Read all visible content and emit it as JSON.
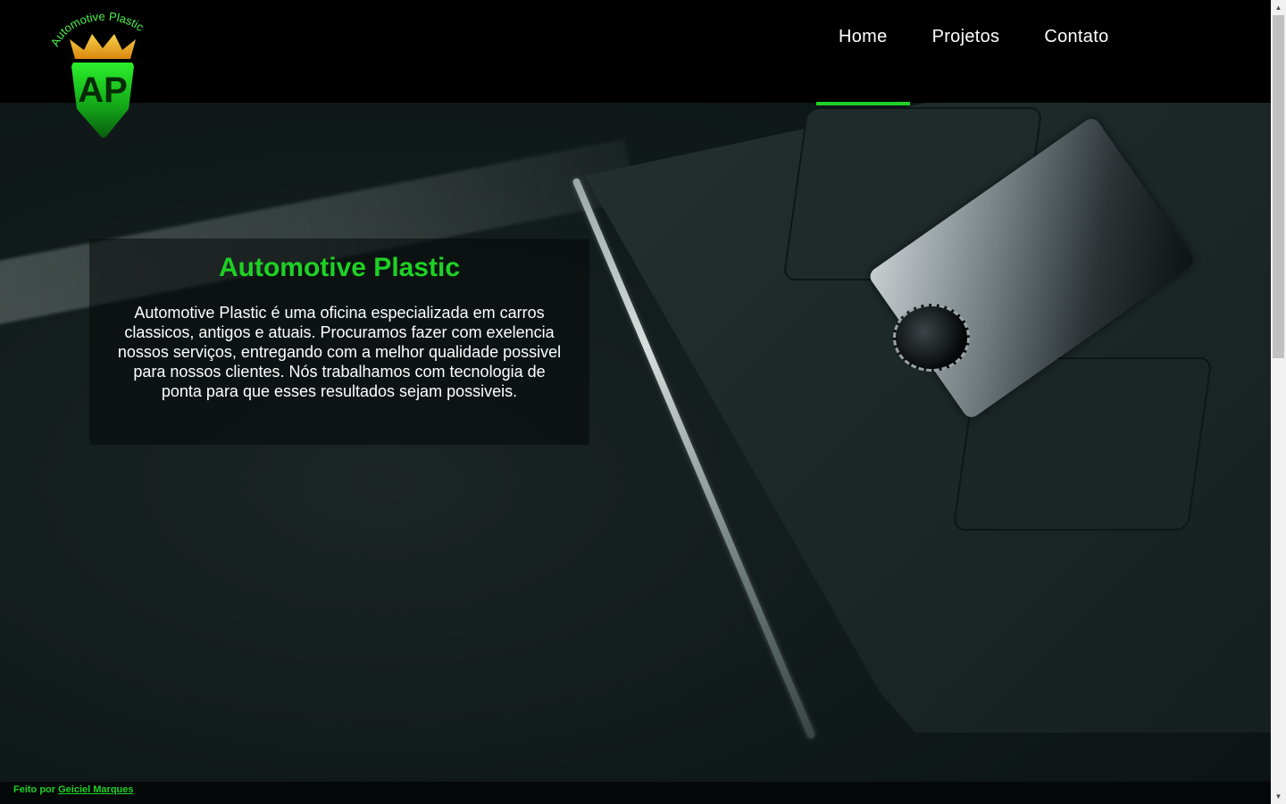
{
  "brand": {
    "logo_text": "Automotive Plastic",
    "logo_initials": "AP"
  },
  "nav": {
    "items": [
      {
        "label": "Home",
        "active": true
      },
      {
        "label": "Projetos",
        "active": false
      },
      {
        "label": "Contato",
        "active": false
      }
    ]
  },
  "hero": {
    "title": "Automotive Plastic",
    "description": "Automotive Plastic é uma oficina especializada em carros classicos, antigos e atuais. Procuramos fazer com exelencia nossos serviços, entregando com a melhor qualidade possivel para nossos clientes. Nós trabalhamos com tecnologia de ponta para que esses resultados sejam possiveis."
  },
  "footer": {
    "prefix": "Feito por",
    "author": "Geiciel Marques"
  },
  "colors": {
    "accent": "#1ed125",
    "header_bg": "#000000",
    "text": "#ffffff"
  }
}
